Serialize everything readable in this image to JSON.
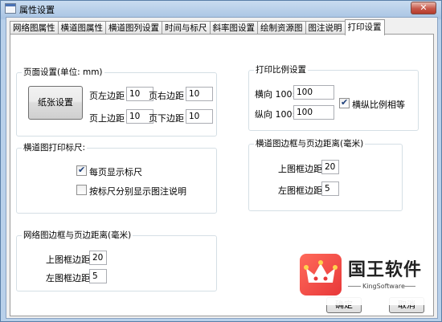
{
  "window": {
    "title": "属性设置",
    "close_label": "✕"
  },
  "tabs": [
    {
      "label": "网络图属性",
      "active": false
    },
    {
      "label": "横道图属性",
      "active": false
    },
    {
      "label": "横道图列设置",
      "active": false
    },
    {
      "label": "时间与标尺",
      "active": false
    },
    {
      "label": "斜率图设置",
      "active": false
    },
    {
      "label": "绘制资源图",
      "active": false
    },
    {
      "label": "图注说明",
      "active": false
    },
    {
      "label": "打印设置",
      "active": true
    }
  ],
  "page_setup": {
    "title": "页面设置(单位: mm)",
    "paper_button": "纸张设置",
    "left_margin_label": "页左边距",
    "left_margin": "10",
    "right_margin_label": "页右边距",
    "right_margin": "10",
    "top_margin_label": "页上边距",
    "top_margin": "10",
    "bottom_margin_label": "页下边距",
    "bottom_margin": "10"
  },
  "print_scale": {
    "title": "打印比例设置",
    "horizontal_label": "横向 100:",
    "horizontal_value": "100",
    "vertical_label": "纵向 100:",
    "vertical_value": "100",
    "equal_ratio_label": "横纵比例相等",
    "equal_ratio_checked": true
  },
  "gantt_ruler": {
    "title": "横道图打印标尺:",
    "each_page_label": "每页显示标尺",
    "each_page_checked": true,
    "separate_label": "按标尺分别显示图注说明",
    "separate_checked": false
  },
  "gantt_border": {
    "title": "横道图边框与页边距离(毫米)",
    "top_label": "上图框边距",
    "top_value": "20",
    "left_label": "左图框边距",
    "left_value": "5"
  },
  "network_border": {
    "title": "网络图边框与页边距离(毫米)",
    "top_label": "上图框边距",
    "top_value": "20",
    "left_label": "左图框边距",
    "left_value": "5"
  },
  "footer": {
    "ok_label": "确定",
    "cancel_label": "取消"
  },
  "watermark": {
    "title": "国王软件",
    "subtitle": "KingSoftware"
  }
}
